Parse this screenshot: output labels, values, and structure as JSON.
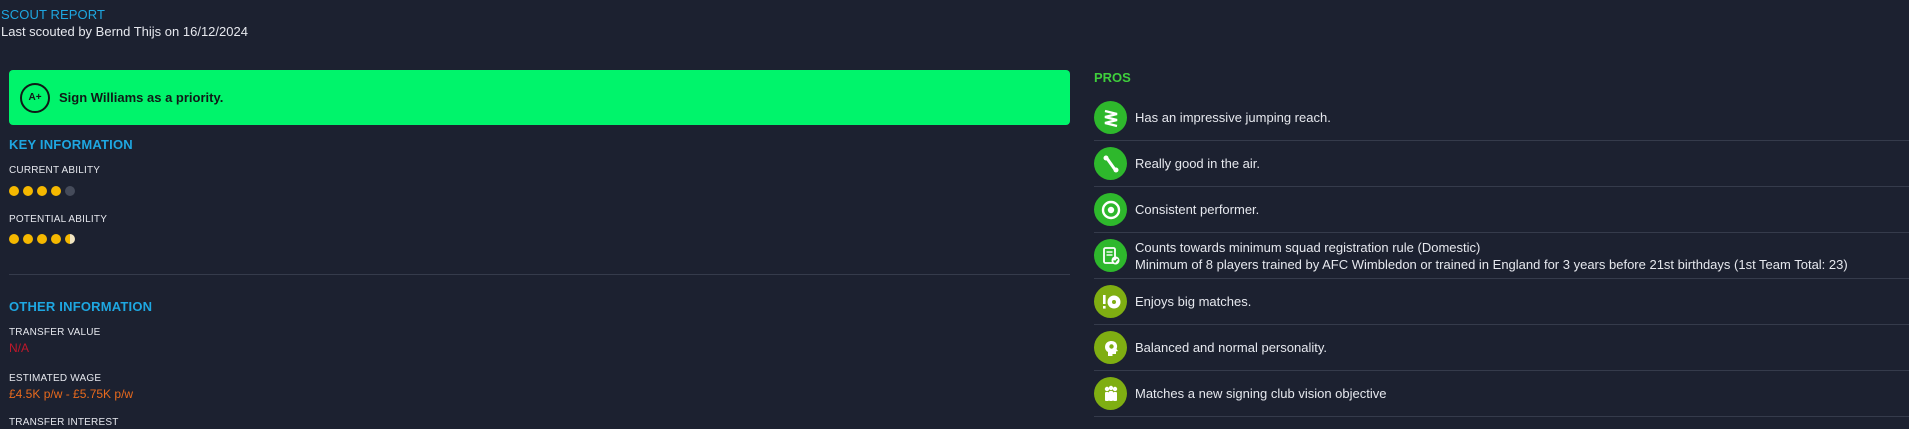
{
  "header": {
    "title": "SCOUT REPORT",
    "subtitle": "Last scouted by Bernd Thijs on 16/12/2024"
  },
  "recommendation": {
    "grade": "A+",
    "text": "Sign Williams as a priority.",
    "color": "#00f46b"
  },
  "key_information": {
    "heading": "KEY INFORMATION",
    "current_ability": {
      "label": "CURRENT ABILITY",
      "stars": 4,
      "max": 5
    },
    "potential_ability": {
      "label": "POTENTIAL ABILITY",
      "stars": 4.5,
      "max": 5
    }
  },
  "other_information": {
    "heading": "OTHER INFORMATION",
    "transfer_value": {
      "label": "TRANSFER VALUE",
      "value": "N/A"
    },
    "estimated_wage": {
      "label": "ESTIMATED WAGE",
      "value": "£4.5K p/w - £5.75K p/w"
    },
    "transfer_interest": {
      "label": "TRANSFER INTEREST"
    }
  },
  "pros": {
    "heading": "PROS",
    "items": [
      {
        "icon": "jumping-reach-icon",
        "color": "#2eb82c",
        "text": "Has an impressive jumping reach."
      },
      {
        "icon": "aerial-ability-icon",
        "color": "#2eb82c",
        "text": "Really good in the air."
      },
      {
        "icon": "consistency-icon",
        "color": "#2eb82c",
        "text": "Consistent performer."
      },
      {
        "icon": "registration-icon",
        "color": "#2eb82c",
        "text": "Counts towards minimum squad registration rule (Domestic)",
        "detail": "Minimum of 8 players trained by AFC Wimbledon or trained in England for 3 years before 21st birthdays (1st Team Total: 23)"
      },
      {
        "icon": "big-matches-icon",
        "color": "#7fae12",
        "text": "Enjoys big matches."
      },
      {
        "icon": "personality-icon",
        "color": "#7fae12",
        "text": "Balanced and normal personality."
      },
      {
        "icon": "club-vision-icon",
        "color": "#7fae12",
        "text": "Matches a new signing club vision objective"
      }
    ]
  }
}
